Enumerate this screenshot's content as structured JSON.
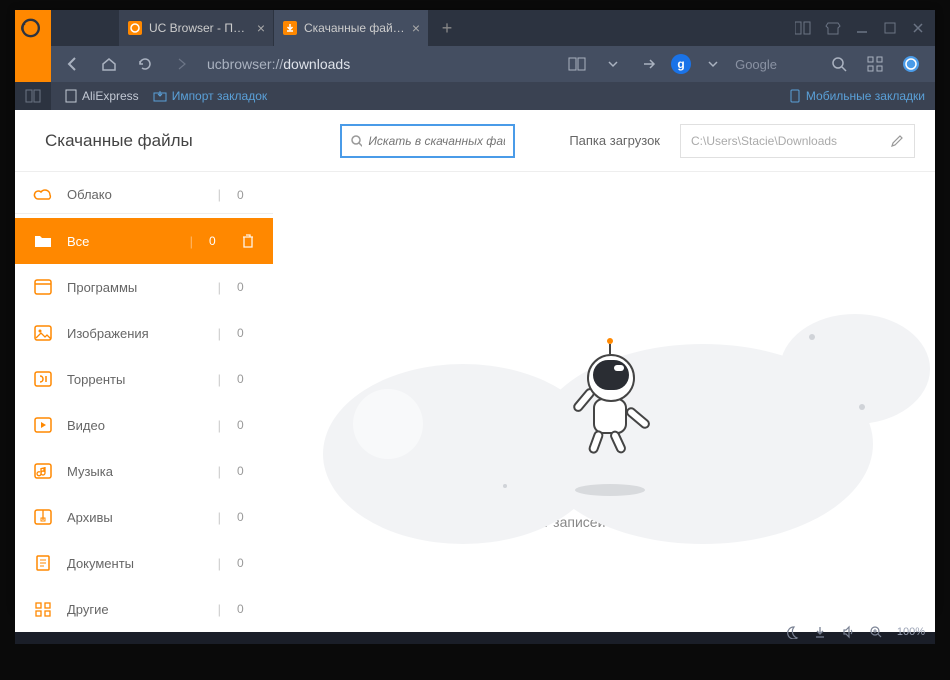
{
  "tabs": [
    {
      "label": "UC Browser - Погода, ...",
      "icon_color": "#f80",
      "active": false
    },
    {
      "label": "Скачанные файлы",
      "icon_color": "#f80",
      "active": true
    }
  ],
  "url_prefix": "ucbrowser://",
  "url_path": "downloads",
  "search_engine": "Google",
  "search_badge_letter": "g",
  "bookmarks": {
    "aliexpress": "AliExpress",
    "import": "Импорт закладок",
    "mobile": "Мобильные закладки"
  },
  "page": {
    "title": "Скачанные файлы",
    "search_placeholder": "Искать в скачанных файла",
    "folder_label": "Папка загрузок",
    "folder_path": "C:\\Users\\Stacie\\Downloads",
    "empty_text": "Нет записей о загрузках"
  },
  "categories": [
    {
      "id": "cloud",
      "label": "Облако",
      "count": "0"
    },
    {
      "id": "all",
      "label": "Все",
      "count": "0",
      "active": true
    },
    {
      "id": "programs",
      "label": "Программы",
      "count": "0"
    },
    {
      "id": "images",
      "label": "Изображения",
      "count": "0"
    },
    {
      "id": "torrents",
      "label": "Торренты",
      "count": "0"
    },
    {
      "id": "video",
      "label": "Видео",
      "count": "0"
    },
    {
      "id": "music",
      "label": "Музыка",
      "count": "0"
    },
    {
      "id": "archives",
      "label": "Архивы",
      "count": "0"
    },
    {
      "id": "documents",
      "label": "Документы",
      "count": "0"
    },
    {
      "id": "other",
      "label": "Другие",
      "count": "0"
    }
  ],
  "statusbar": {
    "zoom": "100%"
  }
}
